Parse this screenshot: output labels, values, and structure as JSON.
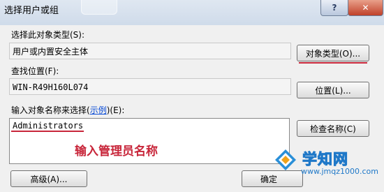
{
  "window": {
    "title": "选择用户或组",
    "help_button": "?",
    "close_button": "✕"
  },
  "object_type": {
    "label": "选择此对象类型(S):",
    "value": "用户或内置安全主体",
    "button": "对象类型(O)..."
  },
  "location": {
    "label": "查找位置(F):",
    "value": "WIN-R49H160L074",
    "button": "位置(L)..."
  },
  "names": {
    "label_pre": "输入对象名称来选择(",
    "label_link": "示例",
    "label_post": ")(E):",
    "value": "Administrators",
    "check_button": "检查名称(C)"
  },
  "annotation": "输入管理员名称",
  "footer": {
    "advanced_button": "高级(A)...",
    "ok_button": "确定"
  },
  "watermark": {
    "title": "学知网",
    "url": "www.jmqz1000.com"
  },
  "colors": {
    "annotation_red": "#c8263a",
    "link_blue": "#0a4bd6",
    "watermark_blue": "#1f78c8"
  }
}
